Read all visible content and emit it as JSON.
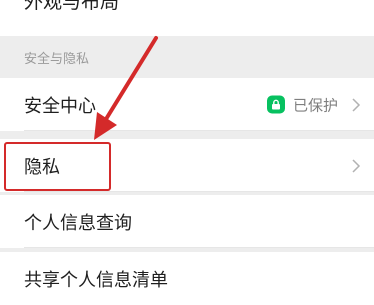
{
  "previous_item": {
    "label": "外观与布局"
  },
  "section": {
    "header": "安全与隐私"
  },
  "rows": [
    {
      "label": "安全中心",
      "status": "已保护"
    },
    {
      "label": "隐私"
    },
    {
      "label": "个人信息查询"
    },
    {
      "label": "共享个人信息清单"
    }
  ],
  "colors": {
    "annotation": "#d42a2a",
    "lock_badge": "#07c160"
  },
  "icons": {
    "status": "lock-icon",
    "row_action": "chevron-right-icon"
  }
}
